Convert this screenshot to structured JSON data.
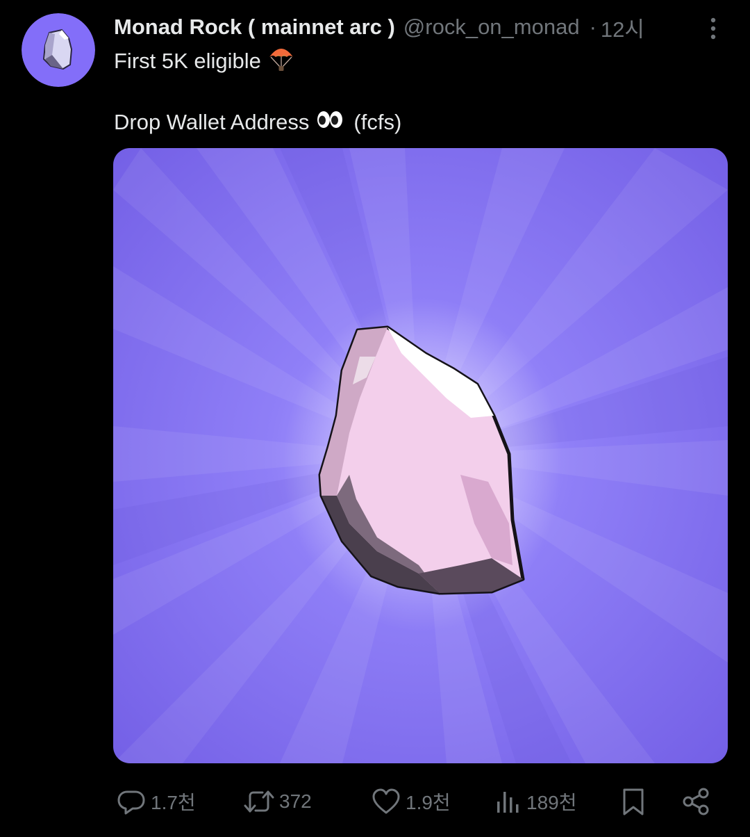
{
  "post": {
    "display_name": "Monad Rock ( mainnet arc )",
    "handle": "@rock_on_monad",
    "separator": "·",
    "time": "12시",
    "line1": "First 5K eligible",
    "line1_emoji": "parachute-emoji",
    "line2": "Drop Wallet Address",
    "line2_emoji": "eyes-emoji",
    "line2_suffix": "(fcfs)"
  },
  "media": {
    "alt": "pink rock on purple radial background",
    "accent_color": "#8b7cf6"
  },
  "actions": {
    "reply_count": "1.7천",
    "repost_count": "372",
    "like_count": "1.9천",
    "view_count": "189천"
  },
  "icons": {
    "reply": "reply-icon",
    "repost": "repost-icon",
    "like": "like-icon",
    "views": "views-icon",
    "bookmark": "bookmark-icon",
    "share": "share-icon",
    "more": "more-icon"
  },
  "colors": {
    "background": "#000000",
    "text": "#e7e9ea",
    "muted": "#71767b",
    "avatar_bg": "#836ef9"
  }
}
